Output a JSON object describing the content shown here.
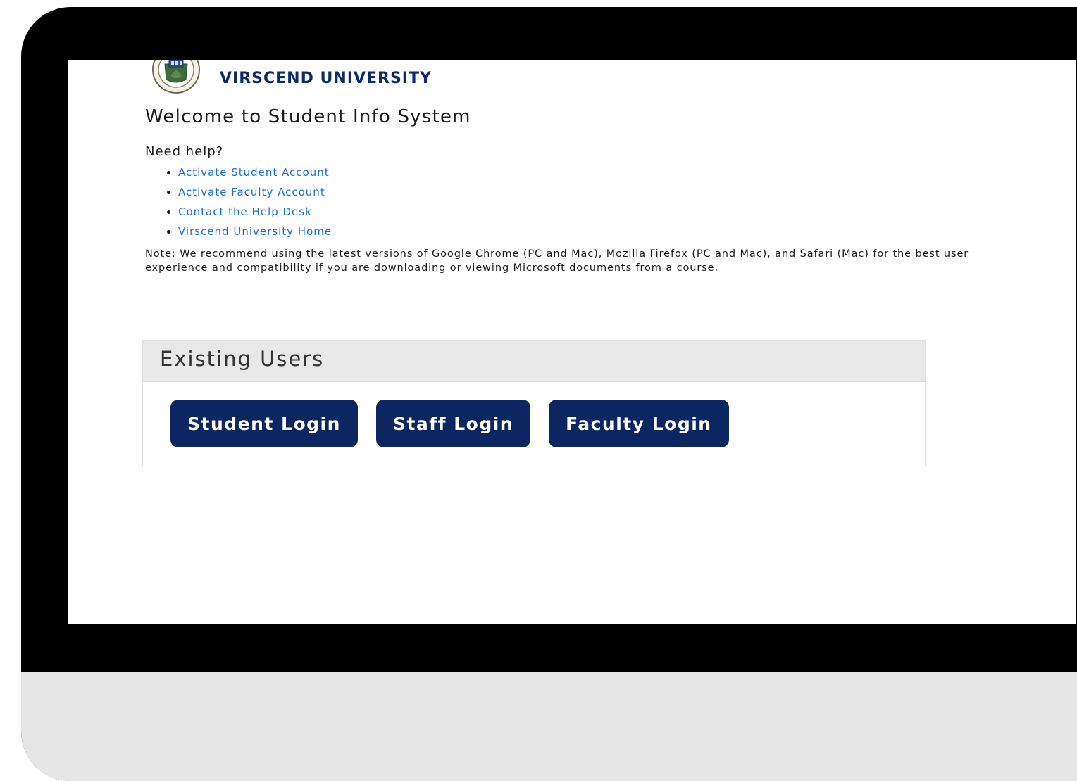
{
  "brand": {
    "name": "VIRSCEND UNIVERSITY",
    "seal_icon": "university-seal-icon",
    "color": "#0a2a6b"
  },
  "welcome": {
    "title": "Welcome to Student Info System"
  },
  "help": {
    "heading": "Need help?",
    "links": [
      {
        "label": "Activate Student Account"
      },
      {
        "label": "Activate Faculty Account"
      },
      {
        "label": "Contact the Help Desk"
      },
      {
        "label": "Virscend University Home"
      }
    ],
    "link_color": "#1a6fd6"
  },
  "note": {
    "text": "Note: We recommend using the latest versions of Google Chrome (PC and Mac), Mozilla Firefox (PC and Mac), and Safari (Mac) for the best user experience and compatibility if you are downloading or viewing Microsoft documents from a course."
  },
  "existing_users": {
    "title": "Existing Users",
    "buttons": [
      {
        "label": "Student Login"
      },
      {
        "label": "Staff Login"
      },
      {
        "label": "Faculty Login"
      }
    ],
    "button_color": "#0b2660"
  }
}
